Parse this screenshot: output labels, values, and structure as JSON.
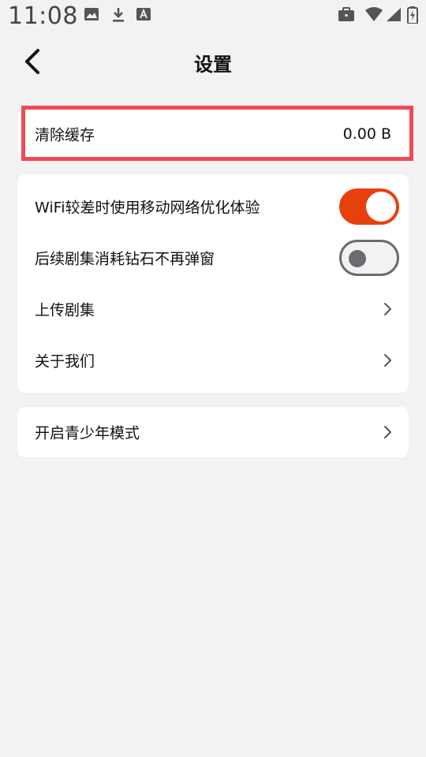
{
  "status_bar": {
    "time": "11:08",
    "icons": [
      "image-icon",
      "download-icon",
      "font-a-icon",
      "briefcase-icon",
      "wifi-icon",
      "signal-icon",
      "battery-charging-icon"
    ]
  },
  "header": {
    "title": "设置"
  },
  "cache": {
    "label": "清除缓存",
    "value": "0.00 B"
  },
  "settings": {
    "items": [
      {
        "label": "WiFi较差时使用移动网络优化体验",
        "control": "toggle",
        "on": true
      },
      {
        "label": "后续剧集消耗钻石不再弹窗",
        "control": "toggle",
        "on": false
      },
      {
        "label": "上传剧集",
        "control": "chevron"
      },
      {
        "label": "关于我们",
        "control": "chevron"
      }
    ]
  },
  "teen_mode": {
    "label": "开启青少年模式"
  },
  "colors": {
    "accent": "#e8400c",
    "highlight": "#f04a55",
    "background": "#f2f2f2",
    "card": "#ffffff"
  }
}
